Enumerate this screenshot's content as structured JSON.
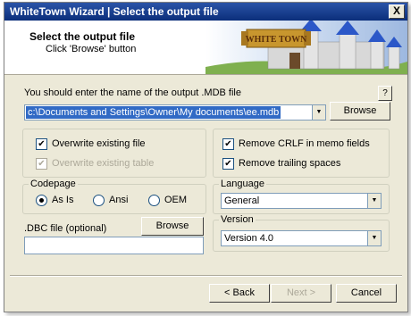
{
  "window": {
    "title": "WhiteTown Wizard | Select the output file",
    "close_glyph": "X"
  },
  "header": {
    "title": "Select the output file",
    "subtitle": "Click 'Browse' button",
    "banner_text": "WHITE TOWN"
  },
  "output": {
    "instruction": "You should enter the name of the output .MDB file",
    "help_label": "?",
    "path_value": "c:\\Documents and Settings\\Owner\\My documents\\ee.mdb",
    "browse_label": "Browse"
  },
  "options_left": {
    "overwrite_file": {
      "label": "Overwrite existing file",
      "checked": true,
      "enabled": true
    },
    "overwrite_table": {
      "label": "Overwrite existing table",
      "checked": true,
      "enabled": false
    }
  },
  "options_right": {
    "remove_crlf": {
      "label": "Remove CRLF in memo fields",
      "checked": true
    },
    "remove_spaces": {
      "label": "Remove trailing spaces",
      "checked": true
    }
  },
  "codepage": {
    "title": "Codepage",
    "options": [
      {
        "label": "As Is",
        "selected": true
      },
      {
        "label": "Ansi",
        "selected": false
      },
      {
        "label": "OEM",
        "selected": false
      }
    ]
  },
  "dbc": {
    "label": ".DBC file (optional)",
    "browse_label": "Browse",
    "value": ""
  },
  "language": {
    "title": "Language",
    "selected": "General"
  },
  "version": {
    "title": "Version",
    "selected": "Version 4.0"
  },
  "footer": {
    "back_label": "< Back",
    "next_label": "Next >",
    "cancel_label": "Cancel"
  },
  "colors": {
    "titlebar": "#0b2e7a",
    "selection": "#316ac5",
    "dialog_bg": "#ece9d8"
  },
  "icons": {
    "check": "✔",
    "dropdown": "▼"
  }
}
